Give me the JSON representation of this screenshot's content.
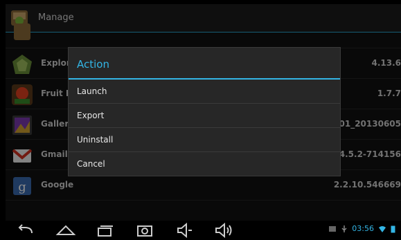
{
  "actionbar": {
    "title": "Manage",
    "app_icon": "android-settings-icon"
  },
  "apps": [
    {
      "name": "",
      "version": "",
      "icon": "apk-icon"
    },
    {
      "name": "Explore",
      "version": "4.13.6",
      "icon": "explorer-icon"
    },
    {
      "name": "Fruit N",
      "version": "1.7.7",
      "icon": "fruit-ninja-icon"
    },
    {
      "name": "Gallery",
      "version": "001_20130605",
      "icon": "gallery-icon"
    },
    {
      "name": "Gmail",
      "version": "4.5.2-714156",
      "icon": "gmail-icon"
    },
    {
      "name": "Google",
      "version": "2.2.10.546669",
      "icon": "google-icon"
    }
  ],
  "dialog": {
    "title": "Action",
    "options": [
      "Launch",
      "Export",
      "Uninstall",
      "Cancel"
    ]
  },
  "statusbar": {
    "time": "03:56"
  },
  "colors": {
    "accent": "#33b5e5"
  }
}
